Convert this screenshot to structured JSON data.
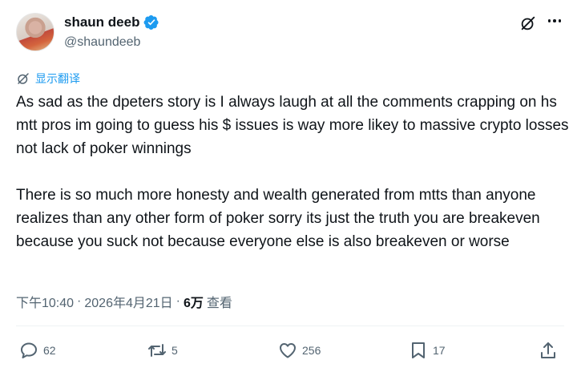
{
  "author": {
    "display_name": "shaun deeb",
    "handle": "@shaundeeb",
    "verified": true,
    "verified_color": "#1d9bf0"
  },
  "header": {
    "grok_icon": "grok-icon",
    "more_icon": "more-icon"
  },
  "translate": {
    "label": "显示翻译",
    "color": "#1d9bf0"
  },
  "tweet": {
    "paragraphs": [
      "As sad as the dpeters story is I always laugh at all the comments crapping on hs mtt pros im going to guess his $ issues is way more likey to massive crypto losses not lack of poker winnings",
      "There is so much more honesty and wealth generated from mtts than anyone realizes than any other form of poker sorry its just the truth you are breakeven because you suck not because everyone else is also breakeven or worse"
    ]
  },
  "meta": {
    "time": "下午10:40",
    "separator": "·",
    "date": "2026年4月21日",
    "views_count": "6万",
    "views_label": "查看"
  },
  "actions": {
    "replies": "62",
    "reposts": "5",
    "likes": "256",
    "bookmarks": "17"
  }
}
